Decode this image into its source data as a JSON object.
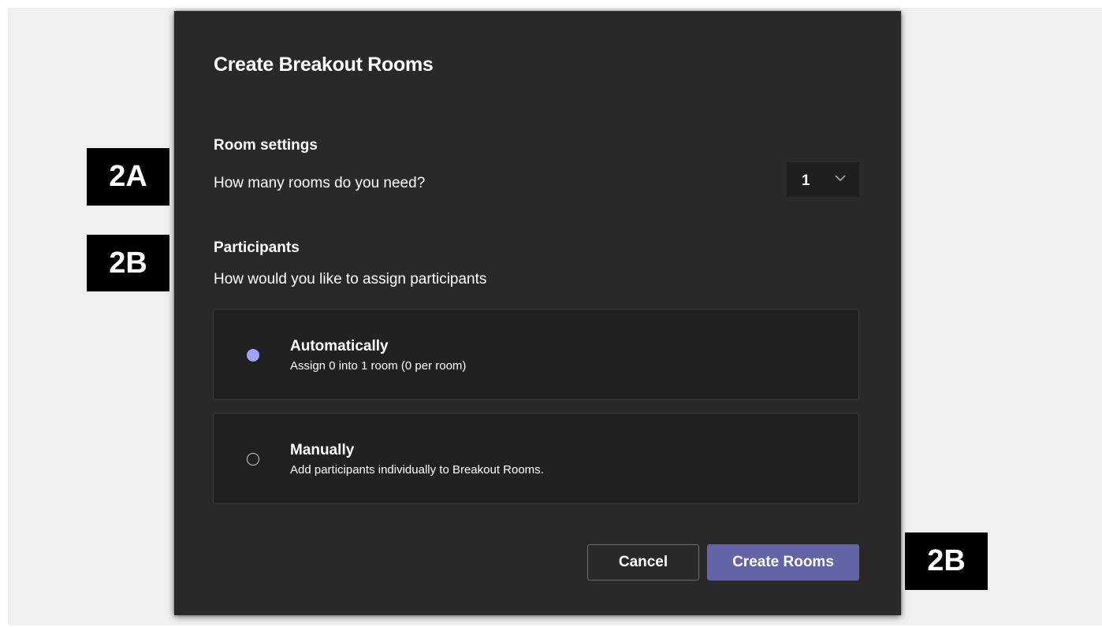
{
  "dialog": {
    "title": "Create Breakout Rooms",
    "room_settings": {
      "heading": "Room settings",
      "question": "How many rooms do you need?",
      "rooms_count": "1"
    },
    "participants": {
      "heading": "Participants",
      "question": "How would you like to assign participants",
      "options": [
        {
          "title": "Automatically",
          "description": "Assign 0 into 1 room (0 per room)",
          "selected": true
        },
        {
          "title": "Manually",
          "description": "Add participants individually to Breakout Rooms.",
          "selected": false
        }
      ]
    },
    "buttons": {
      "cancel": "Cancel",
      "create": "Create Rooms"
    }
  },
  "annotations": {
    "rooms_tag": "2A",
    "participants_tag": "2B",
    "create_tag": "2B"
  },
  "colors": {
    "dialog_bg": "#292929",
    "accent": "#6264a7",
    "radio_checked": "#9ea2ff",
    "stage_bg": "#f0f0f0",
    "annotation_bg": "#000000"
  },
  "icons": {
    "dropdown": "chevron-down-icon",
    "radio_checked": "radio-checked-icon",
    "radio_unchecked": "radio-unchecked-icon"
  }
}
